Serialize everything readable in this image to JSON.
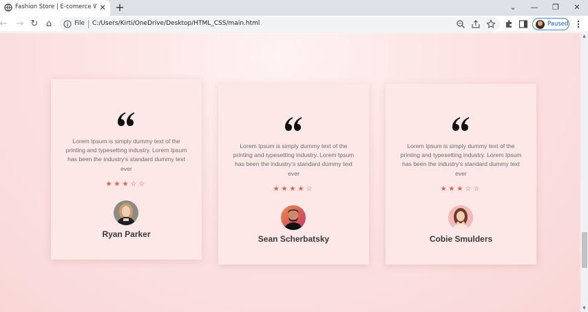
{
  "browser": {
    "tab_title": "Fashion Store | E-comerce Websi",
    "tab_close": "✕",
    "new_tab": "+",
    "window_controls": {
      "chevron": "⌄",
      "minimize": "—",
      "restore": "❐",
      "close": "✕"
    },
    "nav": {
      "back": "←",
      "forward": "→",
      "reload": "↻",
      "home": "⌂"
    },
    "address_scheme": "File",
    "url": "C:/Users/Kirti/OneDrive/Desktop/HTML_CSS/main.html",
    "profile_status": "Paused",
    "icons": [
      "info-icon",
      "zoom-icon",
      "share-icon",
      "bookmark-star-icon",
      "extensions-icon",
      "side-panel-icon",
      "menu-icon"
    ]
  },
  "testimonials": [
    {
      "text": "Lorem Ipsum is simply dummy text of the printing and typesetting industry. Lorem Ipsum has been the industry's standard dummy text ever",
      "stars_display": "★★★☆☆",
      "rating": 3,
      "name": "Ryan Parker",
      "avatar_icon": "woman-portrait-icon"
    },
    {
      "text": "Lorem Ipsum is simply dummy text of the printing and typesetting industry. Lorem Ipsum has been the industry's standard dummy text ever",
      "stars_display": "★★★★☆",
      "rating": 4,
      "name": "Sean Scherbatsky",
      "avatar_icon": "man-portrait-icon"
    },
    {
      "text": "Lorem Ipsum is simply dummy text of the printing and typesetting industry. Lorem Ipsum has been the industry's standard dummy text ever",
      "stars_display": "★★★☆☆",
      "rating": 3,
      "name": "Cobie Smulders",
      "avatar_icon": "woman-portrait-icon"
    }
  ],
  "colors": {
    "star": "#e85a4f",
    "card_bg": "#fde7e7",
    "page_bg": "#fadada",
    "name_text": "#3a3a3a",
    "body_text": "#6d6d6d",
    "profile_accent": "#1a56b8"
  }
}
